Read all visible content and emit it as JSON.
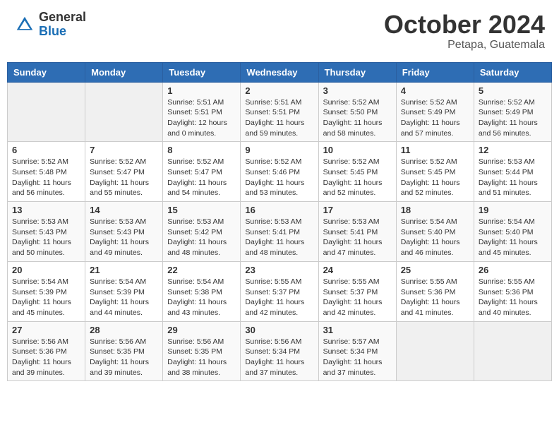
{
  "header": {
    "logo_general": "General",
    "logo_blue": "Blue",
    "month_title": "October 2024",
    "location": "Petapa, Guatemala"
  },
  "weekdays": [
    "Sunday",
    "Monday",
    "Tuesday",
    "Wednesday",
    "Thursday",
    "Friday",
    "Saturday"
  ],
  "weeks": [
    [
      {
        "day": "",
        "info": ""
      },
      {
        "day": "",
        "info": ""
      },
      {
        "day": "1",
        "info": "Sunrise: 5:51 AM\nSunset: 5:51 PM\nDaylight: 12 hours\nand 0 minutes."
      },
      {
        "day": "2",
        "info": "Sunrise: 5:51 AM\nSunset: 5:51 PM\nDaylight: 11 hours\nand 59 minutes."
      },
      {
        "day": "3",
        "info": "Sunrise: 5:52 AM\nSunset: 5:50 PM\nDaylight: 11 hours\nand 58 minutes."
      },
      {
        "day": "4",
        "info": "Sunrise: 5:52 AM\nSunset: 5:49 PM\nDaylight: 11 hours\nand 57 minutes."
      },
      {
        "day": "5",
        "info": "Sunrise: 5:52 AM\nSunset: 5:49 PM\nDaylight: 11 hours\nand 56 minutes."
      }
    ],
    [
      {
        "day": "6",
        "info": "Sunrise: 5:52 AM\nSunset: 5:48 PM\nDaylight: 11 hours\nand 56 minutes."
      },
      {
        "day": "7",
        "info": "Sunrise: 5:52 AM\nSunset: 5:47 PM\nDaylight: 11 hours\nand 55 minutes."
      },
      {
        "day": "8",
        "info": "Sunrise: 5:52 AM\nSunset: 5:47 PM\nDaylight: 11 hours\nand 54 minutes."
      },
      {
        "day": "9",
        "info": "Sunrise: 5:52 AM\nSunset: 5:46 PM\nDaylight: 11 hours\nand 53 minutes."
      },
      {
        "day": "10",
        "info": "Sunrise: 5:52 AM\nSunset: 5:45 PM\nDaylight: 11 hours\nand 52 minutes."
      },
      {
        "day": "11",
        "info": "Sunrise: 5:52 AM\nSunset: 5:45 PM\nDaylight: 11 hours\nand 52 minutes."
      },
      {
        "day": "12",
        "info": "Sunrise: 5:53 AM\nSunset: 5:44 PM\nDaylight: 11 hours\nand 51 minutes."
      }
    ],
    [
      {
        "day": "13",
        "info": "Sunrise: 5:53 AM\nSunset: 5:43 PM\nDaylight: 11 hours\nand 50 minutes."
      },
      {
        "day": "14",
        "info": "Sunrise: 5:53 AM\nSunset: 5:43 PM\nDaylight: 11 hours\nand 49 minutes."
      },
      {
        "day": "15",
        "info": "Sunrise: 5:53 AM\nSunset: 5:42 PM\nDaylight: 11 hours\nand 48 minutes."
      },
      {
        "day": "16",
        "info": "Sunrise: 5:53 AM\nSunset: 5:41 PM\nDaylight: 11 hours\nand 48 minutes."
      },
      {
        "day": "17",
        "info": "Sunrise: 5:53 AM\nSunset: 5:41 PM\nDaylight: 11 hours\nand 47 minutes."
      },
      {
        "day": "18",
        "info": "Sunrise: 5:54 AM\nSunset: 5:40 PM\nDaylight: 11 hours\nand 46 minutes."
      },
      {
        "day": "19",
        "info": "Sunrise: 5:54 AM\nSunset: 5:40 PM\nDaylight: 11 hours\nand 45 minutes."
      }
    ],
    [
      {
        "day": "20",
        "info": "Sunrise: 5:54 AM\nSunset: 5:39 PM\nDaylight: 11 hours\nand 45 minutes."
      },
      {
        "day": "21",
        "info": "Sunrise: 5:54 AM\nSunset: 5:39 PM\nDaylight: 11 hours\nand 44 minutes."
      },
      {
        "day": "22",
        "info": "Sunrise: 5:54 AM\nSunset: 5:38 PM\nDaylight: 11 hours\nand 43 minutes."
      },
      {
        "day": "23",
        "info": "Sunrise: 5:55 AM\nSunset: 5:37 PM\nDaylight: 11 hours\nand 42 minutes."
      },
      {
        "day": "24",
        "info": "Sunrise: 5:55 AM\nSunset: 5:37 PM\nDaylight: 11 hours\nand 42 minutes."
      },
      {
        "day": "25",
        "info": "Sunrise: 5:55 AM\nSunset: 5:36 PM\nDaylight: 11 hours\nand 41 minutes."
      },
      {
        "day": "26",
        "info": "Sunrise: 5:55 AM\nSunset: 5:36 PM\nDaylight: 11 hours\nand 40 minutes."
      }
    ],
    [
      {
        "day": "27",
        "info": "Sunrise: 5:56 AM\nSunset: 5:36 PM\nDaylight: 11 hours\nand 39 minutes."
      },
      {
        "day": "28",
        "info": "Sunrise: 5:56 AM\nSunset: 5:35 PM\nDaylight: 11 hours\nand 39 minutes."
      },
      {
        "day": "29",
        "info": "Sunrise: 5:56 AM\nSunset: 5:35 PM\nDaylight: 11 hours\nand 38 minutes."
      },
      {
        "day": "30",
        "info": "Sunrise: 5:56 AM\nSunset: 5:34 PM\nDaylight: 11 hours\nand 37 minutes."
      },
      {
        "day": "31",
        "info": "Sunrise: 5:57 AM\nSunset: 5:34 PM\nDaylight: 11 hours\nand 37 minutes."
      },
      {
        "day": "",
        "info": ""
      },
      {
        "day": "",
        "info": ""
      }
    ]
  ]
}
